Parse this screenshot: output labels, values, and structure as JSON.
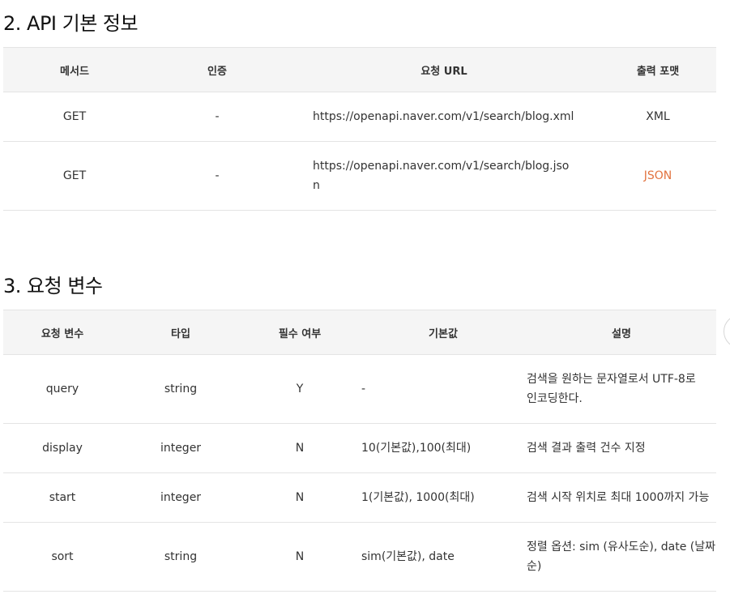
{
  "api_basic": {
    "title": "2. API 기본 정보",
    "headers": [
      "메서드",
      "인증",
      "요청 URL",
      "출력 포맷"
    ],
    "rows": [
      {
        "method": "GET",
        "auth": "-",
        "url_line1": "https://openapi.naver.com/v1/search/blog.xml",
        "url_line2": "",
        "format": "XML"
      },
      {
        "method": "GET",
        "auth": "-",
        "url_line1": "https://openapi.naver.com/v1/search/blog.jso",
        "url_line2": "n",
        "format": "JSON"
      }
    ]
  },
  "request_params": {
    "title": "3. 요청 변수",
    "headers": [
      "요청 변수",
      "타입",
      "필수 여부",
      "기본값",
      "설명"
    ],
    "rows": [
      {
        "name": "query",
        "type": "string",
        "required": "Y",
        "default": "-",
        "desc_line1": "검색을 원하는 문자열로서 UTF-8로",
        "desc_line2": "인코딩한다."
      },
      {
        "name": "display",
        "type": "integer",
        "required": "N",
        "default": "10(기본값),100(최대)",
        "desc_line1": "검색 결과 출력 건수 지정",
        "desc_line2": ""
      },
      {
        "name": "start",
        "type": "integer",
        "required": "N",
        "default": "1(기본값), 1000(최대)",
        "desc_line1": "검색 시작 위치로 최대 1000까지 가능",
        "desc_line2": ""
      },
      {
        "name": "sort",
        "type": "string",
        "required": "N",
        "default": "sim(기본값), date",
        "desc_line1": "정렬 옵션: sim (유사도순), date (날짜",
        "desc_line2": "순)"
      }
    ]
  },
  "colors": {
    "accent_json": "#e2733f",
    "header_bg": "#f5f5f5",
    "border": "#e4e4e4"
  }
}
